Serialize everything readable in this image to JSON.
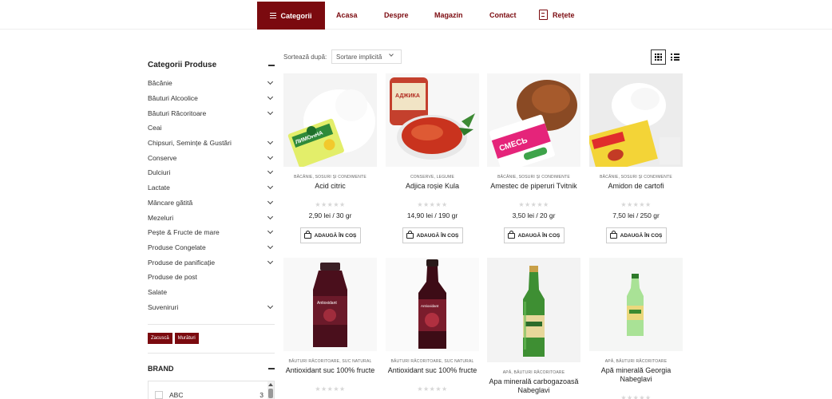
{
  "nav": {
    "categories_label": "Categorii",
    "links": [
      "Acasa",
      "Despre",
      "Magazin",
      "Contact"
    ],
    "recipes_label": "Rețete",
    "accent_color": "#7b0a0f"
  },
  "sidebar": {
    "title": "Categorii Produse",
    "categories": [
      {
        "label": "Băcănie",
        "expandable": true
      },
      {
        "label": "Băuturi Alcoolice",
        "expandable": true
      },
      {
        "label": "Băuturi Răcoritoare",
        "expandable": true
      },
      {
        "label": "Ceai",
        "expandable": false
      },
      {
        "label": "Chipsuri, Semințe & Gustări",
        "expandable": true
      },
      {
        "label": "Conserve",
        "expandable": true
      },
      {
        "label": "Dulciuri",
        "expandable": true
      },
      {
        "label": "Lactate",
        "expandable": true
      },
      {
        "label": "Mâncare gătită",
        "expandable": true
      },
      {
        "label": "Mezeluri",
        "expandable": true
      },
      {
        "label": "Pește & Fructe de mare",
        "expandable": true
      },
      {
        "label": "Produse Congelate",
        "expandable": true
      },
      {
        "label": "Produse de panificație",
        "expandable": true
      },
      {
        "label": "Produse de post",
        "expandable": false
      },
      {
        "label": "Salate",
        "expandable": false
      },
      {
        "label": "Suveniruri",
        "expandable": true
      }
    ],
    "tags": [
      "Zacuscă",
      "Murături"
    ],
    "brand": {
      "title": "BRAND",
      "items": [
        {
          "label": "ABC",
          "count": "3"
        }
      ]
    }
  },
  "toolbar": {
    "sort_label": "Sortează după:",
    "sort_value": "Sortare implicită"
  },
  "products": [
    {
      "category": "Băcănie, Sosuri și Condimente",
      "name": "Acid citric",
      "price": "2,90 lei / 30 gr",
      "button": "ADAUGĂ ÎN COȘ",
      "image_icon": "citric-acid-pouch"
    },
    {
      "category": "Conserve, Legume",
      "name": "Adjica roșie Kula",
      "price": "14,90 lei / 190 gr",
      "button": "ADAUGĂ ÎN COȘ",
      "image_icon": "adjika-jar"
    },
    {
      "category": "Băcănie, Sosuri și Condimente",
      "name": "Amestec de piperuri Tvitnik",
      "price": "3,50 lei / 20 gr",
      "button": "ADAUGĂ ÎN COȘ",
      "image_icon": "pepper-mix-pouch"
    },
    {
      "category": "Băcănie, Sosuri și Condimente",
      "name": "Amidon de cartofi",
      "price": "7,50 lei / 250 gr",
      "button": "ADAUGĂ ÎN COȘ",
      "image_icon": "potato-starch-pouch"
    },
    {
      "category": "Băuturi Răcoritoare, Suc natural",
      "name": "Antioxidant suc 100% fructe",
      "image_icon": "juice-bottle-small"
    },
    {
      "category": "Băuturi Răcoritoare, Suc natural",
      "name": "Antioxidant suc 100% fructe",
      "image_icon": "juice-bottle-large"
    },
    {
      "category": "Apă, Băuturi Răcoritoare",
      "name": "Apa minerală carbogazoasă Nabeglavi",
      "image_icon": "green-glass-water-bottle"
    },
    {
      "category": "Apă, Băuturi Răcoritoare",
      "name": "Apă minerală Georgia Nabeglavi",
      "image_icon": "green-plastic-water-bottle"
    }
  ]
}
